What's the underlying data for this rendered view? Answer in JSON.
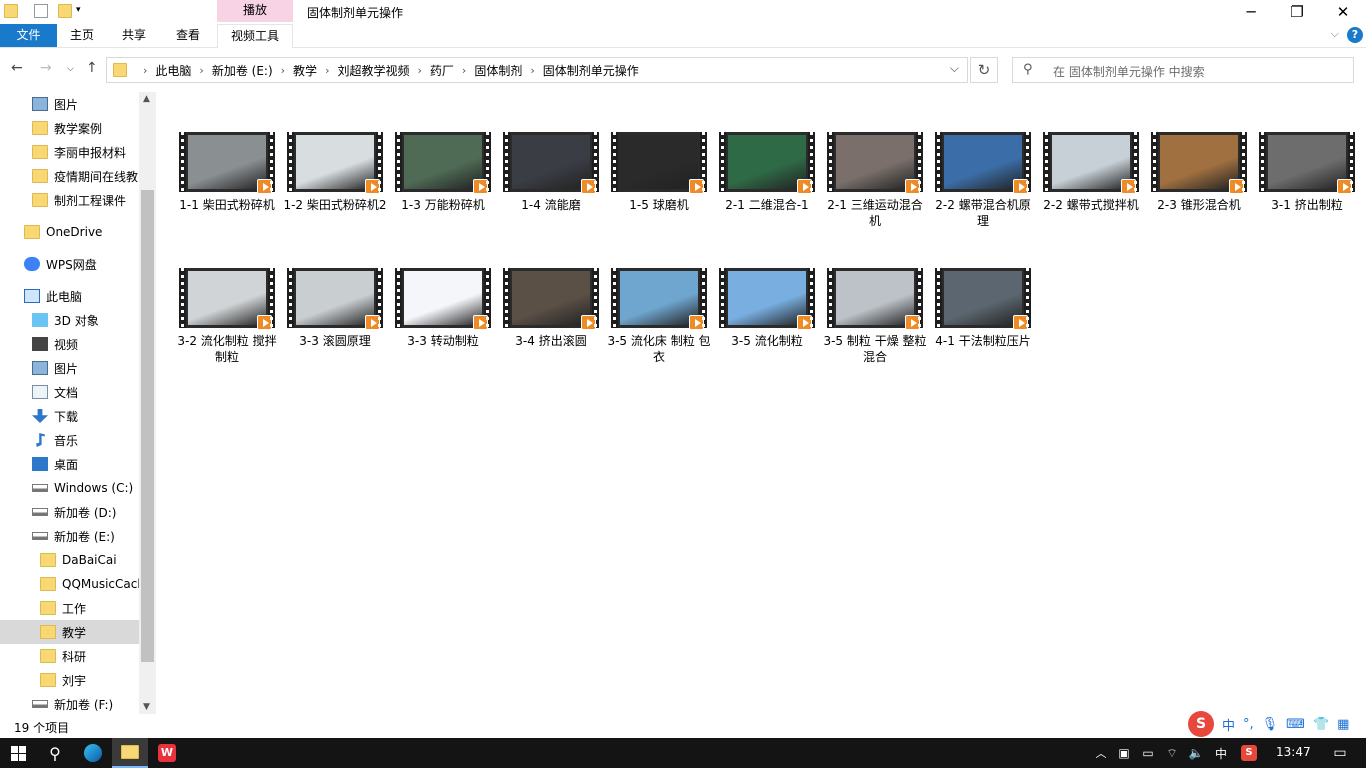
{
  "window": {
    "title": "固体制剂单元操作",
    "context_tab": "播放"
  },
  "ribbon": {
    "tabs": [
      "文件",
      "主页",
      "共享",
      "查看",
      "视频工具"
    ]
  },
  "address": {
    "crumbs": [
      "此电脑",
      "新加卷 (E:)",
      "教学",
      "刘超教学视频",
      "药厂",
      "固体制剂",
      "固体制剂单元操作"
    ]
  },
  "search": {
    "placeholder": "在 固体制剂单元操作 中搜索"
  },
  "sidebar": {
    "items": [
      {
        "label": "图片",
        "icon": "pictures-icon"
      },
      {
        "label": "教学案例",
        "icon": "folder-icon"
      },
      {
        "label": "李丽申报材料",
        "icon": "folder-icon"
      },
      {
        "label": "疫情期间在线教",
        "icon": "folder-icon"
      },
      {
        "label": "制剂工程课件",
        "icon": "folder-icon"
      },
      {
        "label": "OneDrive",
        "icon": "folder-icon"
      },
      {
        "label": "WPS网盘",
        "icon": "cloud-icon"
      },
      {
        "label": "此电脑",
        "icon": "computer-icon"
      },
      {
        "label": "3D 对象",
        "icon": "3d-objects-icon"
      },
      {
        "label": "视频",
        "icon": "video-icon"
      },
      {
        "label": "图片",
        "icon": "pictures-icon"
      },
      {
        "label": "文档",
        "icon": "documents-icon"
      },
      {
        "label": "下载",
        "icon": "download-icon"
      },
      {
        "label": "音乐",
        "icon": "music-icon"
      },
      {
        "label": "桌面",
        "icon": "desktop-icon"
      },
      {
        "label": "Windows (C:)",
        "icon": "drive-icon"
      },
      {
        "label": "新加卷 (D:)",
        "icon": "drive-icon"
      },
      {
        "label": "新加卷 (E:)",
        "icon": "drive-icon"
      },
      {
        "label": "DaBaiCai",
        "icon": "folder-icon"
      },
      {
        "label": "QQMusicCach",
        "icon": "folder-icon"
      },
      {
        "label": "工作",
        "icon": "folder-icon"
      },
      {
        "label": "教学",
        "icon": "folder-icon"
      },
      {
        "label": "科研",
        "icon": "folder-icon"
      },
      {
        "label": "刘宇",
        "icon": "folder-icon"
      },
      {
        "label": "新加卷 (F:)",
        "icon": "drive-icon"
      }
    ],
    "selected": "教学"
  },
  "files": [
    {
      "name": "1-1 柴田式粉碎机",
      "color": "#8a8f92"
    },
    {
      "name": "1-2 柴田式粉碎机2",
      "color": "#d8dde0"
    },
    {
      "name": "1-3 万能粉碎机",
      "color": "#4f6b55"
    },
    {
      "name": "1-4 流能磨",
      "color": "#3a3d44"
    },
    {
      "name": "1-5 球磨机",
      "color": "#2a2a2a"
    },
    {
      "name": "2-1 二维混合-1",
      "color": "#2f6a46"
    },
    {
      "name": "2-1 三维运动混合机",
      "color": "#7a6f6a"
    },
    {
      "name": "2-2 螺带混合机原理",
      "color": "#3b6ea8"
    },
    {
      "name": "2-2 螺带式搅拌机",
      "color": "#c7d0d6"
    },
    {
      "name": "2-3 锥形混合机",
      "color": "#a07040"
    },
    {
      "name": "3-1 挤出制粒",
      "color": "#6d6d6d"
    },
    {
      "name": "3-2 流化制粒 搅拌制粒",
      "color": "#d0d4d6"
    },
    {
      "name": "3-3 滚圆原理",
      "color": "#c9ced1"
    },
    {
      "name": "3-3 转动制粒",
      "color": "#f4f6fa"
    },
    {
      "name": "3-4 挤出滚圆",
      "color": "#5a5046"
    },
    {
      "name": "3-5 流化床 制粒 包衣",
      "color": "#6fa6cf"
    },
    {
      "name": "3-5 流化制粒",
      "color": "#78aee0"
    },
    {
      "name": "3-5 制粒 干燥 整粒 混合",
      "color": "#bcc2c8"
    },
    {
      "name": "4-1 干法制粒压片",
      "color": "#5c6670"
    }
  ],
  "status": {
    "count": "19 个项目"
  },
  "ime": {
    "lang": "中",
    "punct": "°,"
  },
  "taskbar": {
    "ime": "中",
    "time": "13:47"
  }
}
